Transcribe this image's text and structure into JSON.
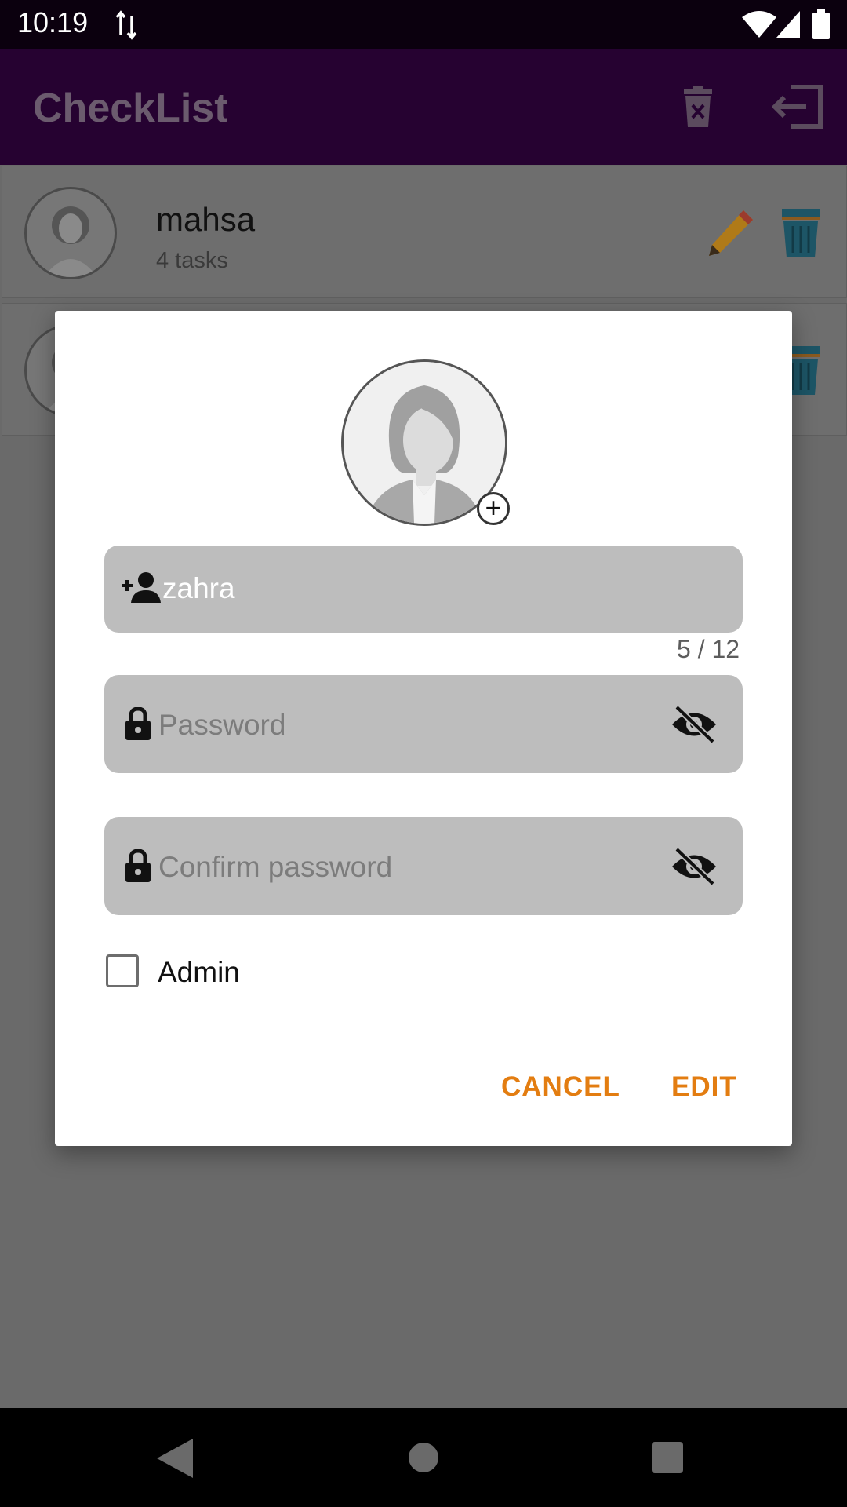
{
  "status_bar": {
    "time": "10:19"
  },
  "app_bar": {
    "title": "CheckList"
  },
  "users": [
    {
      "name": "mahsa",
      "subtitle": "4 tasks"
    },
    {
      "name": "",
      "subtitle": ""
    }
  ],
  "dialog": {
    "username": {
      "value": "zahra",
      "counter": "5 / 12"
    },
    "password": {
      "placeholder": "Password"
    },
    "confirm_password": {
      "placeholder": "Confirm password"
    },
    "admin_label": "Admin",
    "cancel_label": "CANCEL",
    "edit_label": "EDIT"
  },
  "colors": {
    "accent": "#e37d11",
    "app_bar": "#260231",
    "status_bar": "#0b000e"
  },
  "icons": [
    "data-transfer-icon",
    "wifi-icon",
    "signal-icon",
    "battery-icon",
    "delete-all-icon",
    "logout-icon",
    "edit-pencil-icon",
    "trash-can-icon",
    "add-user-icon",
    "lock-icon",
    "visibility-off-icon",
    "add-photo-icon",
    "back-icon",
    "home-icon",
    "recents-icon"
  ]
}
